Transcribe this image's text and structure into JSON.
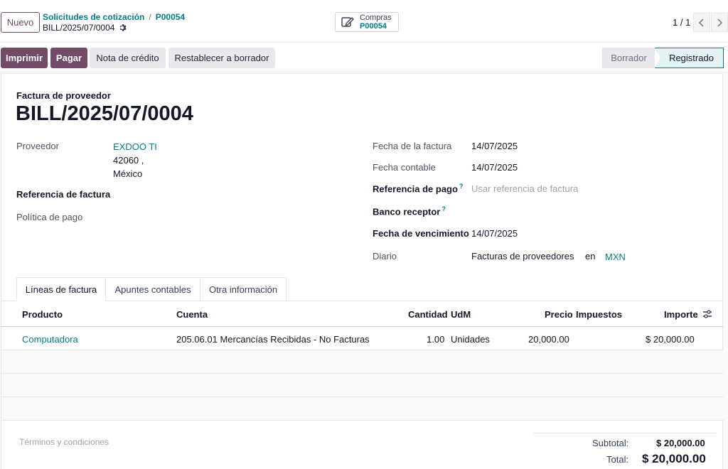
{
  "topbar": {
    "new_label": "Nuevo",
    "breadcrumb": {
      "parent": "Solicitudes de cotización",
      "sep": "/",
      "current": "P00054"
    },
    "record_name": "BILL/2025/07/0004",
    "smart_button": {
      "label": "Compras",
      "value": "P00054"
    },
    "pager": "1 / 1"
  },
  "actions": {
    "print": "Imprimir",
    "pay": "Pagar",
    "credit_note": "Nota de crédito",
    "reset": "Restablecer a borrador"
  },
  "status": {
    "draft": "Borrador",
    "posted": "Registrado"
  },
  "doc": {
    "type_label": "Factura de proveedor",
    "title": "BILL/2025/07/0004"
  },
  "left_fields": {
    "vendor_label": "Proveedor",
    "vendor_name": "EXDOO TI",
    "vendor_addr1": "42060 ,",
    "vendor_addr2": "México",
    "bill_ref_label": "Referencia de factura",
    "payment_policy_label": "Política de pago"
  },
  "right_fields": {
    "invoice_date_label": "Fecha de la factura",
    "invoice_date": "14/07/2025",
    "accounting_date_label": "Fecha contable",
    "accounting_date": "14/07/2025",
    "payment_ref_label": "Referencia de pago",
    "payment_ref_placeholder": "Usar referencia de factura",
    "bank_label": "Banco receptor",
    "due_date_label": "Fecha de vencimiento",
    "due_date": "14/07/2025",
    "journal_label": "Diario",
    "journal": "Facturas de proveedores",
    "in_label": "en",
    "currency": "MXN",
    "help_mark": "?"
  },
  "tabs": [
    "Líneas de factura",
    "Apuntes contables",
    "Otra información"
  ],
  "table": {
    "headers": {
      "product": "Producto",
      "account": "Cuenta",
      "qty": "Cantidad",
      "uom": "UdM",
      "price": "Precio",
      "taxes": "Impuestos",
      "amount": "Importe"
    },
    "rows": [
      {
        "product": "Computadora",
        "account": "205.06.01 Mercancías Recibidas - No Facturas",
        "qty": "1.00",
        "uom": "Unidades",
        "price": "20,000.00",
        "taxes": "",
        "amount": "$ 20,000.00"
      }
    ]
  },
  "footer": {
    "terms_placeholder": "Términos y condiciones",
    "subtotal_label": "Subtotal:",
    "subtotal": "$ 20,000.00",
    "total_label": "Total:",
    "total": "$ 20,000.00"
  },
  "colors": {
    "primary": "#714b67",
    "link": "#017e84"
  }
}
